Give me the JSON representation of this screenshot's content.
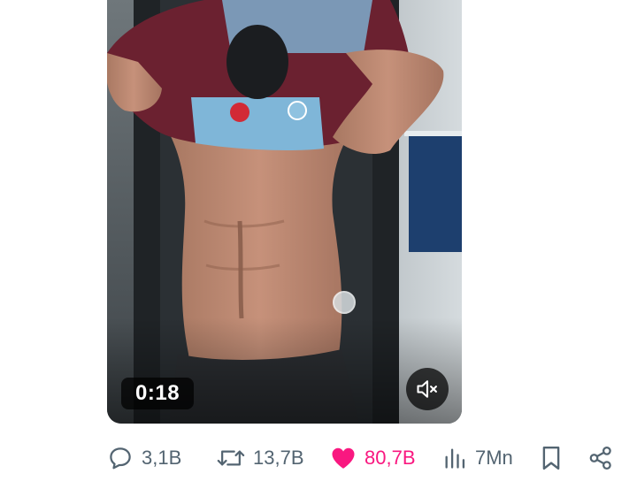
{
  "video": {
    "duration_label": "0:18",
    "muted": true,
    "mute_icon": "speaker-muted-icon"
  },
  "actions": {
    "replies": {
      "icon": "reply-icon",
      "count": "3,1B"
    },
    "reposts": {
      "icon": "repost-icon",
      "count": "13,7B"
    },
    "likes": {
      "icon": "heart-filled-icon",
      "count": "80,7B",
      "liked": true,
      "color": "#f91880"
    },
    "views": {
      "icon": "views-bar-chart-icon",
      "count": "7Mn"
    },
    "bookmark": {
      "icon": "bookmark-icon"
    },
    "share": {
      "icon": "share-icon"
    }
  },
  "colors": {
    "action_gray": "#536471",
    "like_pink": "#f91880",
    "badge_bg": "rgba(0,0,0,0.72)"
  }
}
